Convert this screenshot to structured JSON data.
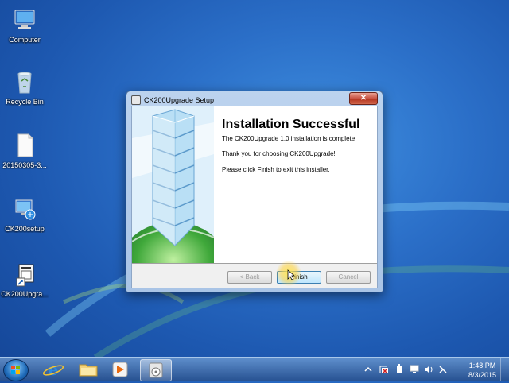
{
  "desktop": {
    "icons": [
      {
        "label": "Computer",
        "icon": "computer-icon"
      },
      {
        "label": "Recycle Bin",
        "icon": "recycle-bin-icon"
      },
      {
        "label": "20150305-3...",
        "icon": "file-icon"
      },
      {
        "label": "CK200setup",
        "icon": "setup-icon"
      },
      {
        "label": "CK200Upgra...",
        "icon": "shortcut-icon"
      }
    ]
  },
  "dialog": {
    "title": "CK200Upgrade Setup",
    "close_label": "✕",
    "heading": "Installation Successful",
    "lines": [
      "The CK200Upgrade 1.0 installation is complete.",
      "Thank you for choosing CK200Upgrade!",
      "Please click Finish to exit this installer."
    ],
    "buttons": {
      "back": "< Back",
      "finish": "Finish",
      "cancel": "Cancel"
    }
  },
  "taskbar": {
    "pinned": [
      "internet-explorer-icon",
      "folder-icon",
      "media-player-icon",
      "setup-app-icon"
    ],
    "active_index": 3,
    "tray_icons": [
      "show-hidden-icons",
      "action-center-icon",
      "power-icon",
      "network-icon",
      "volume-icon",
      "input-icon"
    ],
    "time": "1:48 PM",
    "date": "8/3/2015"
  },
  "colors": {
    "accent": "#2b6fc8",
    "close": "#c75040"
  }
}
